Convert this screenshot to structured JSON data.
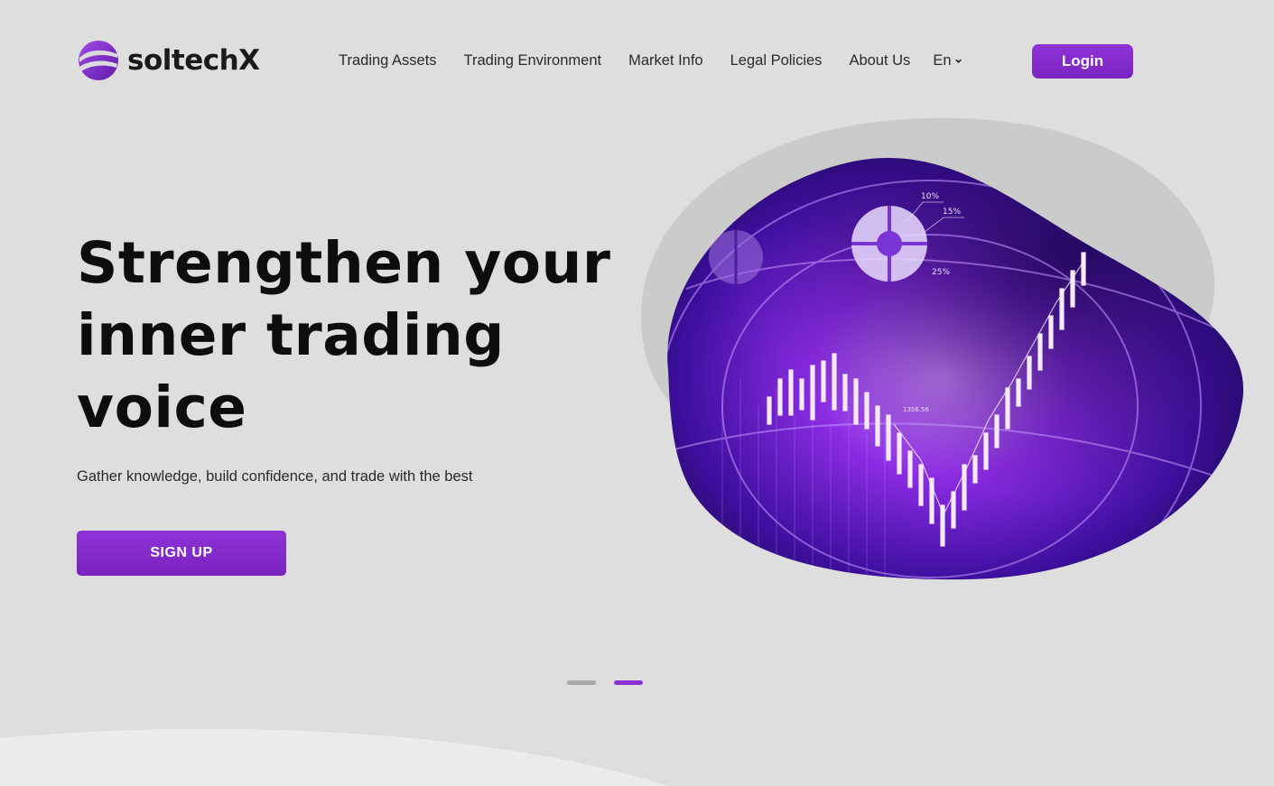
{
  "brand": {
    "name": "soltechX",
    "logo_icon": "globe-swirl-icon",
    "accent": "#8b2fd3"
  },
  "nav": {
    "items": [
      "Trading Assets",
      "Trading Environment",
      "Market Info",
      "Legal Policies",
      "About Us"
    ],
    "language": "En",
    "login_label": "Login"
  },
  "hero": {
    "title": "Strengthen your inner trading voice",
    "subtitle": "Gather knowledge, build confidence, and trade with the best",
    "signup_label": "SIGN UP",
    "image_labels": [
      "10%",
      "15%",
      "25%",
      "1356.56"
    ]
  },
  "carousel": {
    "slides": 2,
    "active_index": 1
  }
}
